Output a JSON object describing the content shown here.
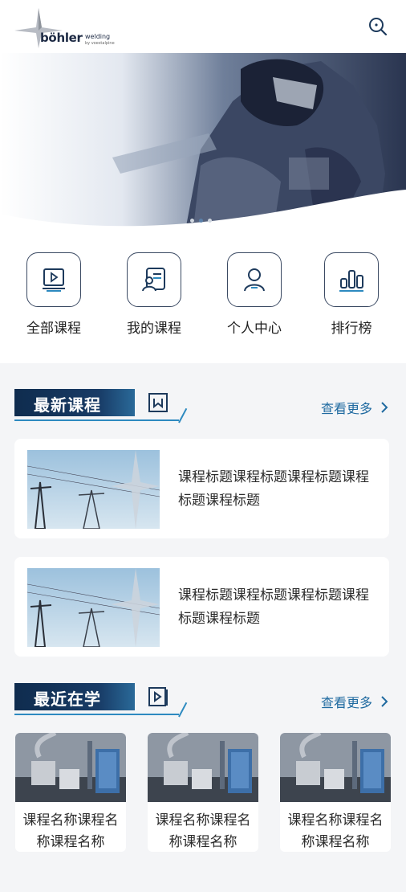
{
  "header": {
    "logo_main": "böhler",
    "logo_sub": "welding",
    "logo_tag": "by voestalpine"
  },
  "banner": {
    "dots": 3,
    "active_dot": 2
  },
  "menu": [
    {
      "label": "全部课程",
      "icon": "video-course-icon"
    },
    {
      "label": "我的课程",
      "icon": "user-list-icon"
    },
    {
      "label": "个人中心",
      "icon": "person-icon"
    },
    {
      "label": "排行榜",
      "icon": "bar-chart-icon"
    }
  ],
  "latest": {
    "title": "最新课程",
    "more": "查看更多",
    "courses": [
      {
        "title": "课程标题课程标题课程标题课程标题课程标题"
      },
      {
        "title": "课程标题课程标题课程标题课程标题课程标题"
      }
    ]
  },
  "recent": {
    "title": "最近在学",
    "more": "查看更多",
    "courses": [
      {
        "name": "课程名称课程名称课程名称"
      },
      {
        "name": "课程名称课程名称课程名称"
      },
      {
        "name": "课程名称课程名称课程名称"
      }
    ]
  }
}
